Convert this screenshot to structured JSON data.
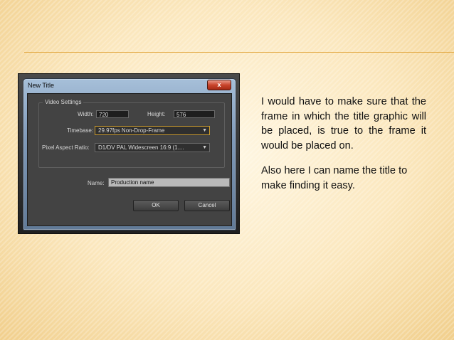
{
  "dialog": {
    "title": "New Title",
    "close_glyph": "x",
    "video_settings": {
      "legend": "Video Settings",
      "width_label": "Width:",
      "width_value": "720",
      "height_label": "Height:",
      "height_value": "576",
      "timebase_label": "Timebase:",
      "timebase_value": "29.97fps Non-Drop-Frame",
      "par_label": "Pixel Aspect Ratio:",
      "par_value": "D1/DV PAL Widescreen 16:9 (1...."
    },
    "name_label": "Name:",
    "name_value": "Production name",
    "ok_label": "OK",
    "cancel_label": "Cancel"
  },
  "slide": {
    "paragraph1": "I would have to make sure that the frame in which the title graphic will be placed, is true to the frame it would be placed on.",
    "paragraph2": "Also here I can name the title to make finding it easy."
  },
  "colors": {
    "accent_rule": "#e2a73f",
    "dialog_background": "#434343",
    "close_button": "#c9452c"
  },
  "icons": {
    "dropdown": "chevron-down-icon"
  }
}
